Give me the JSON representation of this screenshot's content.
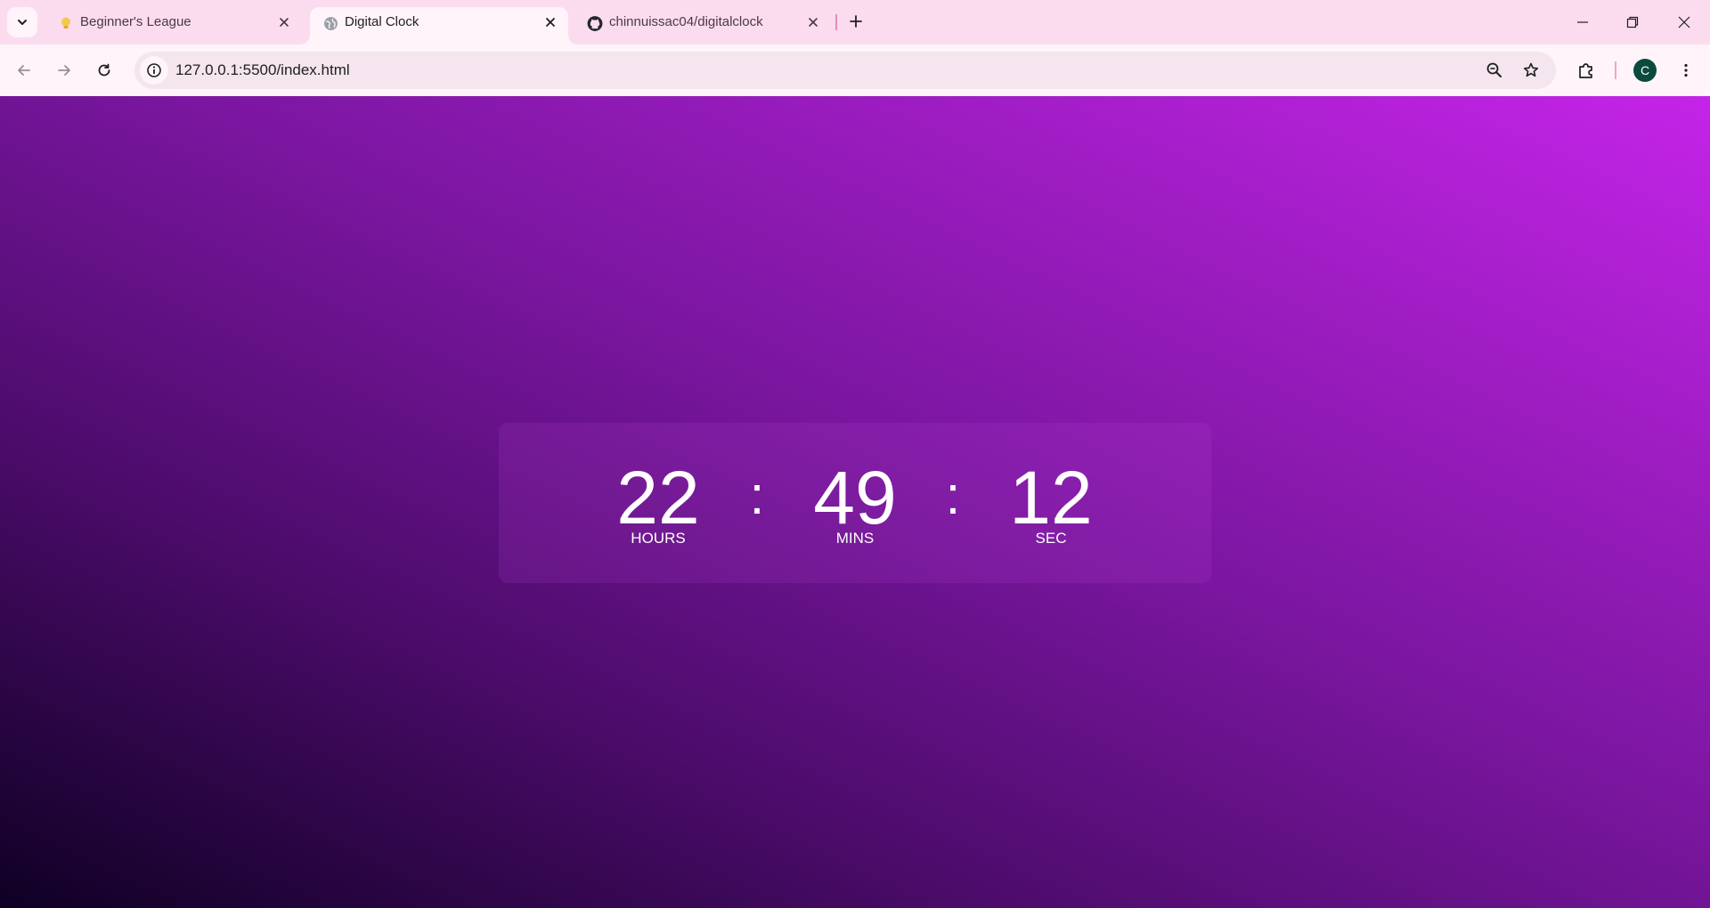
{
  "browser": {
    "tabs": [
      {
        "title": "Beginner's League",
        "favicon": "lightbulb-icon",
        "active": false
      },
      {
        "title": "Digital Clock",
        "favicon": "globe-icon",
        "active": true
      },
      {
        "title": "chinnuissac04/digitalclock",
        "favicon": "github-icon",
        "active": false
      }
    ],
    "url": "127.0.0.1:5500/index.html",
    "profile_initial": "C",
    "colors": {
      "tabstrip": "#fbdcee",
      "toolbar": "#fef4f9",
      "avatar": "#0b4a3e"
    }
  },
  "clock": {
    "hours": "22",
    "minutes": "49",
    "seconds": "12",
    "separator": ":",
    "hours_label": "HOURS",
    "minutes_label": "MINS",
    "seconds_label": "SEC"
  },
  "page": {
    "gradient_colors": [
      "#0f0024",
      "#4d0c6c",
      "#7a169f",
      "#c424e8"
    ]
  }
}
